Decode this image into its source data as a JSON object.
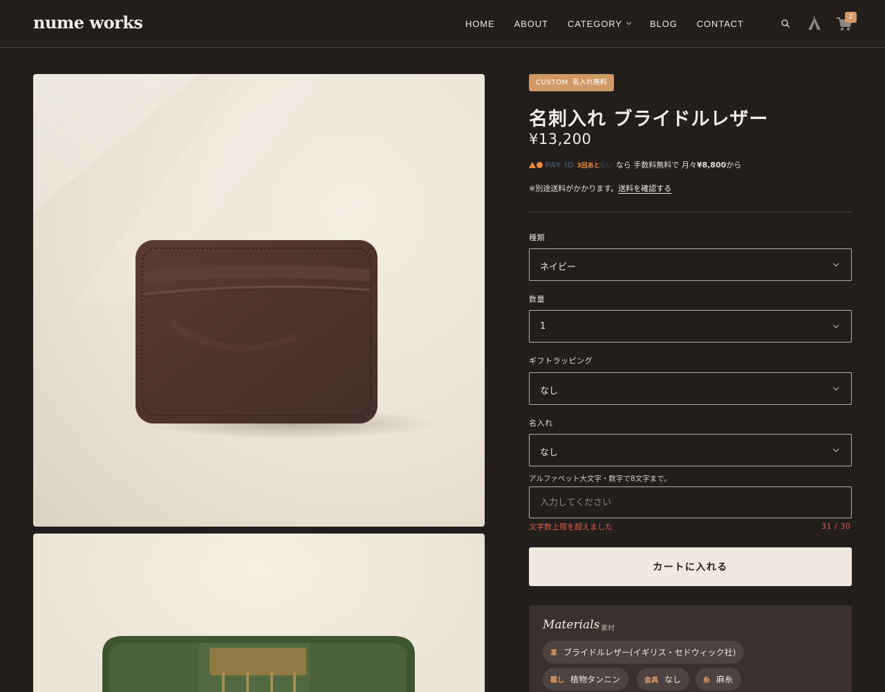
{
  "header": {
    "logo": "nume works",
    "nav": [
      {
        "label": "HOME"
      },
      {
        "label": "ABOUT"
      },
      {
        "label": "CATEGORY"
      },
      {
        "label": "BLOG"
      },
      {
        "label": "CONTACT"
      }
    ],
    "cart_count": "2",
    "icons": [
      "search-icon",
      "tent-icon",
      "cart-icon"
    ]
  },
  "product": {
    "tag_en": "CUSTOM",
    "tag_ja": "名入れ無料",
    "title": "名刺入れ ブライドルレザー",
    "price": "¥13,200",
    "pay": {
      "brand": "PAY ID",
      "sub": "3回あと",
      "sub2": "払い",
      "text_pre": "なら 手数料無料で 月々",
      "amount": "¥8,800",
      "text_post": "から"
    },
    "ship_note": "※別途送料がかかります。",
    "ship_link": "送料を確認する"
  },
  "options": {
    "type": {
      "label": "種類",
      "value": "ネイビー"
    },
    "qty": {
      "label": "数量",
      "value": "1"
    },
    "gift": {
      "label": "ギフトラッピング",
      "value": "なし"
    },
    "name": {
      "label": "名入れ",
      "value": "なし"
    }
  },
  "engraving": {
    "hint": "アルファベット大文字・数字で8文字まで。",
    "placeholder": "入力してください",
    "error": "文字数上限を超えました",
    "counter": "31 / 30"
  },
  "cart_button": "カートに入れる",
  "materials": {
    "title": "Materials",
    "subtitle": "素材",
    "items": [
      {
        "key": "革",
        "value": "ブライドルレザー(イギリス・セドウィック社)"
      },
      {
        "key": "鞣し",
        "value": "植物タンニン"
      },
      {
        "key": "金具",
        "value": "なし"
      },
      {
        "key": "糸",
        "value": "麻糸"
      }
    ]
  },
  "colors": {
    "background": "#221e1c",
    "accent": "#d09a66",
    "error": "#d9604c",
    "button": "#f1e8df"
  }
}
